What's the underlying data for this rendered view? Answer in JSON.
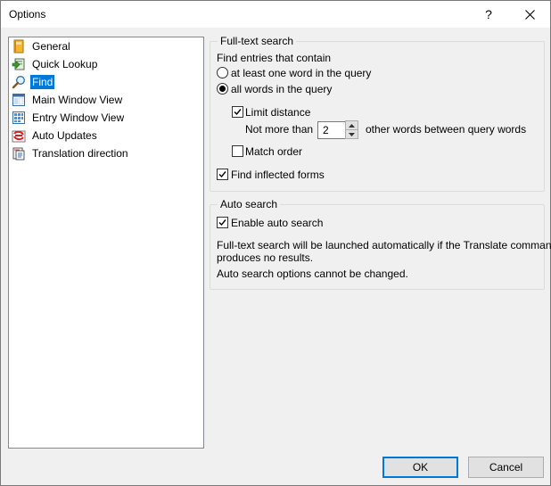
{
  "window": {
    "title": "Options",
    "help_label": "?"
  },
  "nav": {
    "items": [
      {
        "label": "General",
        "icon": "general-icon"
      },
      {
        "label": "Quick Lookup",
        "icon": "quick-lookup-icon"
      },
      {
        "label": "Find",
        "icon": "magnifier-icon",
        "selected": true
      },
      {
        "label": "Main Window View",
        "icon": "main-window-icon"
      },
      {
        "label": "Entry Window View",
        "icon": "entry-window-icon"
      },
      {
        "label": "Auto Updates",
        "icon": "auto-updates-icon"
      },
      {
        "label": "Translation direction",
        "icon": "translation-direction-icon"
      }
    ]
  },
  "fulltext": {
    "title": "Full-text search",
    "find_entries_label": "Find entries that contain",
    "option_any": {
      "label": "at least one word in the query",
      "checked": false
    },
    "option_all": {
      "label": "all words in the query",
      "checked": true
    },
    "limit_distance": {
      "label": "Limit distance",
      "checked": true
    },
    "not_more_than_label": "Not more than",
    "distance_value": "2",
    "distance_suffix": "other words between query words",
    "match_order": {
      "label": "Match order",
      "checked": false
    },
    "inflected_forms": {
      "label": "Find inflected forms",
      "checked": true
    }
  },
  "autosearch": {
    "title": "Auto search",
    "enable": {
      "label": "Enable auto search",
      "checked": true
    },
    "info_line1": "Full-text search will be launched automatically if the Translate command",
    "info_line2": "produces no results.",
    "info_note": "Auto search options cannot be changed."
  },
  "buttons": {
    "ok": "OK",
    "cancel": "Cancel"
  },
  "colors": {
    "selection": "#0078d7",
    "window_bg": "#f0f0f0"
  }
}
